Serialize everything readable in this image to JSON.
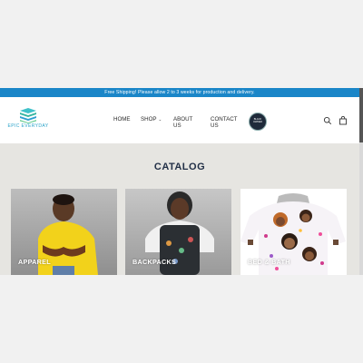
{
  "announcement": "Free Shipping! Please allow 2 to 3 weeks for production and delivery.",
  "brand": {
    "line1": "EPIC",
    "line2": "EVERYDAY"
  },
  "nav": [
    {
      "label": "HOME"
    },
    {
      "label": "SHOP",
      "has_dropdown": true
    },
    {
      "label": "ABOUT US"
    },
    {
      "label": "CONTACT US"
    }
  ],
  "badge_text": [
    "BLACK",
    "OWNED"
  ],
  "icons": {
    "search": "search-icon",
    "cart": "bag-icon",
    "dropdown": "chevron-down-icon"
  },
  "catalog": {
    "title": "CATALOG",
    "cards": [
      {
        "label": "APPAREL"
      },
      {
        "label": "BACKPACKS"
      },
      {
        "label": "BED & BATH"
      }
    ]
  },
  "colors": {
    "announcement_bg": "#1a86c8",
    "title": "#223047",
    "page_bg": "#e6e5e1"
  }
}
